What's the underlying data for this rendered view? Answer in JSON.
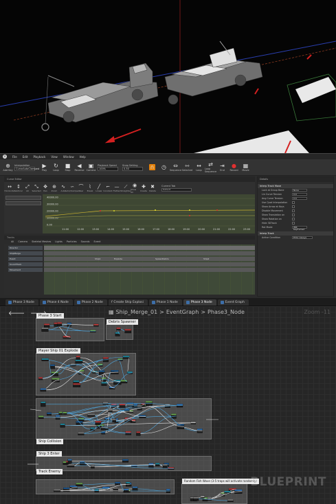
{
  "matinee": {
    "menu": [
      "File",
      "Edit",
      "Playback",
      "View",
      "Window",
      "Help"
    ],
    "interpolation_label": "Interpolation",
    "interpolation_value": "CurveAutoClamped",
    "add_key_label": "Add Key",
    "transport": [
      {
        "label": "Play",
        "icon": "play-icon"
      },
      {
        "label": "Loop",
        "icon": "loop-icon"
      },
      {
        "label": "Stop",
        "icon": "stop-icon"
      },
      {
        "label": "Reverse",
        "icon": "reverse-icon"
      },
      {
        "label": "Camera",
        "icon": "camera-icon"
      }
    ],
    "playback_speed_label": "Playback Speed",
    "playback_speed_value": "100%",
    "snap_setting_label": "Snap Setting",
    "snap_setting_value": "0.50",
    "right_tools": [
      {
        "label": "Sequence",
        "icon": "sequence-icon"
      },
      {
        "label": "Selected",
        "icon": "selected-icon"
      },
      {
        "label": "Loop",
        "icon": "loop-icon"
      },
      {
        "label": "Loop Sequence",
        "icon": "loop-sequence-icon"
      },
      {
        "label": "End",
        "icon": "end-icon"
      },
      {
        "label": "Record",
        "icon": "record-icon"
      },
      {
        "label": "Movie",
        "icon": "movie-icon"
      }
    ],
    "curve_editor_tab": "Curve Editor",
    "curve_tools": [
      "Horizontal",
      "Vertical",
      "All",
      "Selected",
      "Pan",
      "Zoom",
      "Auto",
      "Auto/Clamped",
      "User",
      "Break",
      "Linear",
      "Constant",
      "Flatten",
      "Straighten",
      "Show All",
      "Create",
      "Delete"
    ],
    "current_tab_label": "Current Tab",
    "current_tab_value": "Default",
    "graph_values": [
      "40000.00",
      "30000.00",
      "20000.00",
      "10000.00",
      "0.00"
    ],
    "graph_times": [
      "11:00",
      "12:00",
      "13:00",
      "14:00",
      "15:00",
      "16:00",
      "17:00",
      "18:00",
      "19:00",
      "20:00",
      "21:00",
      "22:00",
      "23:00"
    ],
    "tracks_label": "Tracks",
    "track_tabs": [
      "All",
      "Camera",
      "Skeletal Meshes",
      "Lights",
      "Particles",
      "Sounds",
      "Event"
    ],
    "tracks": [
      {
        "name": "Director"
      },
      {
        "name": "ShipMerge"
      },
      {
        "name": "Event"
      },
      {
        "name": "SoundTrack"
      },
      {
        "name": "Movement"
      }
    ],
    "track_events": [
      "Ship1",
      "Explode",
      "SpawnDebris",
      "Ship2"
    ],
    "details": {
      "header": "Details",
      "section1": "Interp Track Move",
      "rows": [
        {
          "label": "Lock at Group Bone",
          "value": "None"
        },
        {
          "label": "Lin Curve Tension",
          "value": "0.0"
        },
        {
          "label": "Ang Curve Tension",
          "value": "0.0"
        },
        {
          "label": "Use Quat Interpolation",
          "value": ""
        },
        {
          "label": "Show Arrow at Keys",
          "value": ""
        },
        {
          "label": "Disable Movement",
          "value": ""
        },
        {
          "label": "Show Translation on",
          "value": ""
        },
        {
          "label": "Show Rotation on",
          "value": ""
        },
        {
          "label": "Hide 3DTrack",
          "value": ""
        },
        {
          "label": "Rot Mode",
          "value": "IMR Keyframed"
        }
      ],
      "section2": "Interp Track",
      "active_condition_label": "Active Condition",
      "active_condition_value": "ETAC Always"
    }
  },
  "blueprint": {
    "tabs": [
      "Phase 3 Node",
      "Phase 4 Node",
      "Phase 2 Node",
      "Create Ship Explosi",
      "Phase 1 Node",
      "Phase 3 Node",
      "Event Graph"
    ],
    "active_tab": 5,
    "breadcrumb": [
      "Ship_Merge_01",
      "EventGraph",
      "Phase3_Node"
    ],
    "zoom": "Zoom -11",
    "watermark": "BLUEPRINT",
    "comments": [
      "Phase 3 Start",
      "Debris Spawner",
      "Player Ship 01 Explode",
      "Ship Collision",
      "Ship 3 Enter",
      "Track Enemy",
      "Random Fish Wave (3-5 traps will activate randomly)"
    ]
  }
}
